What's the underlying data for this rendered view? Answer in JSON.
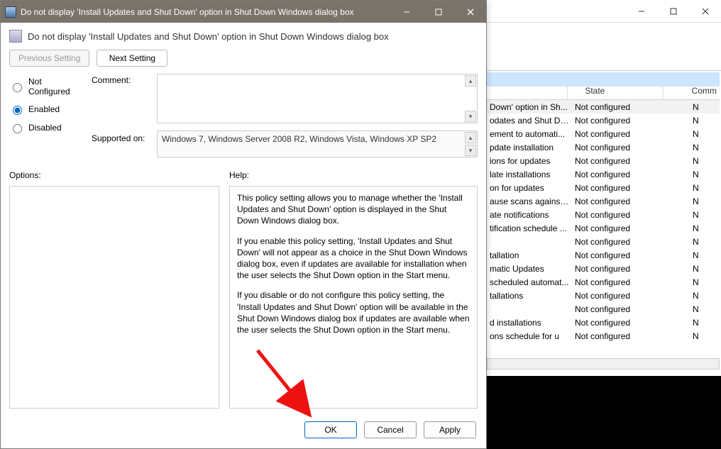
{
  "bg": {
    "header": {
      "state": "State",
      "comment": "Comm"
    },
    "rows": [
      {
        "setting": "Down' option in Sh...",
        "state": "Not configured",
        "comment": "N"
      },
      {
        "setting": "odates and Shut Do...",
        "state": "Not configured",
        "comment": "N"
      },
      {
        "setting": "ement to automati...",
        "state": "Not configured",
        "comment": "N"
      },
      {
        "setting": "pdate installation",
        "state": "Not configured",
        "comment": "N"
      },
      {
        "setting": "ions for updates",
        "state": "Not configured",
        "comment": "N"
      },
      {
        "setting": "late installations",
        "state": "Not configured",
        "comment": "N"
      },
      {
        "setting": "on for updates",
        "state": "Not configured",
        "comment": "N"
      },
      {
        "setting": "ause scans against ...",
        "state": "Not configured",
        "comment": "N"
      },
      {
        "setting": "ate notifications",
        "state": "Not configured",
        "comment": "N"
      },
      {
        "setting": "tification schedule ...",
        "state": "Not configured",
        "comment": "N"
      },
      {
        "setting": "",
        "state": "Not configured",
        "comment": "N"
      },
      {
        "setting": "tallation",
        "state": "Not configured",
        "comment": "N"
      },
      {
        "setting": "matic Updates",
        "state": "Not configured",
        "comment": "N"
      },
      {
        "setting": "scheduled automat...",
        "state": "Not configured",
        "comment": "N"
      },
      {
        "setting": "tallations",
        "state": "Not configured",
        "comment": "N"
      },
      {
        "setting": "",
        "state": "Not configured",
        "comment": "N"
      },
      {
        "setting": "d installations",
        "state": "Not configured",
        "comment": "N"
      },
      {
        "setting": "ons schedule for u",
        "state": "Not configured",
        "comment": "N"
      }
    ]
  },
  "dlg": {
    "title": "Do not display 'Install Updates and Shut Down' option in Shut Down Windows dialog box",
    "header_text": "Do not display 'Install Updates and Shut Down' option in Shut Down Windows dialog box",
    "prev_btn": "Previous Setting",
    "next_btn": "Next Setting",
    "radios": {
      "not_configured": "Not Configured",
      "enabled": "Enabled",
      "disabled": "Disabled"
    },
    "labels": {
      "comment": "Comment:",
      "supported": "Supported on:",
      "options": "Options:",
      "help": "Help:"
    },
    "supported_value": "Windows 7, Windows Server 2008 R2, Windows Vista, Windows XP SP2",
    "help_p1": "This policy setting allows you to manage whether the 'Install Updates and Shut Down' option is displayed in the Shut Down Windows dialog box.",
    "help_p2": "If you enable this policy setting, 'Install Updates and Shut Down' will not appear as a choice in the Shut Down Windows dialog box, even if updates are available for installation when the user selects the Shut Down option in the Start menu.",
    "help_p3": "If you disable or do not configure this policy setting, the 'Install Updates and Shut Down' option will be available in the Shut Down Windows dialog box if updates are available when the user selects the Shut Down option in the Start menu.",
    "buttons": {
      "ok": "OK",
      "cancel": "Cancel",
      "apply": "Apply"
    }
  }
}
